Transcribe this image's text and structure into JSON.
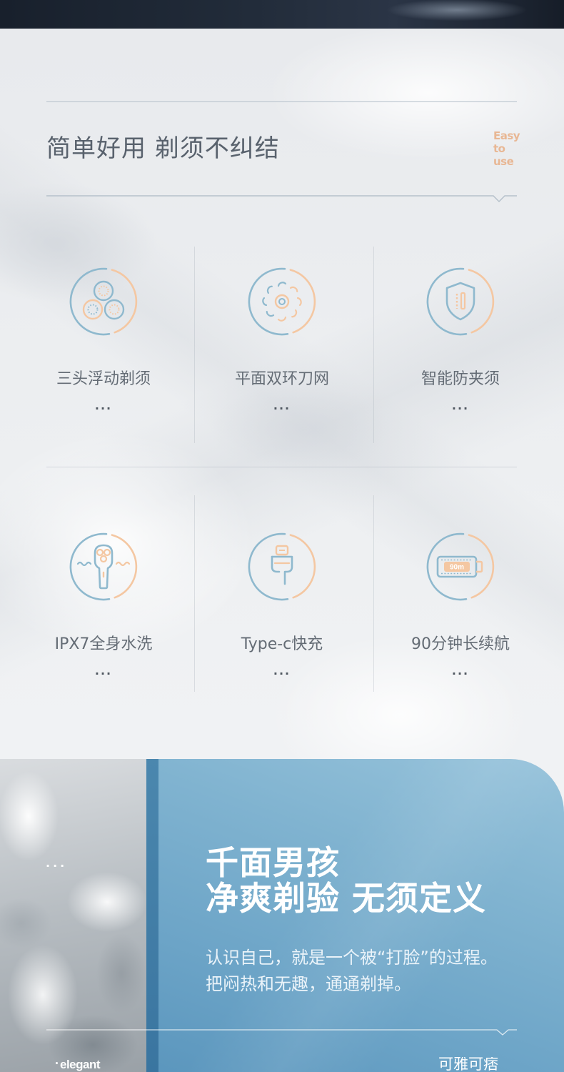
{
  "colors": {
    "accent_blue": "#8fb9ce",
    "accent_peach": "#f4c7a2",
    "title_gray": "#59626d",
    "panel_blue": "#6ca4c7"
  },
  "intro": {
    "title": "简单好用 剃须不纠结",
    "tag_lines": [
      "Easy",
      "to",
      "use"
    ]
  },
  "features": [
    {
      "icon": "three-heads-icon",
      "label": "三头浮动剃须",
      "more": "..."
    },
    {
      "icon": "dual-ring-blade-icon",
      "label": "平面双环刀网",
      "more": "..."
    },
    {
      "icon": "anti-pinch-shield-icon",
      "label": "智能防夹须",
      "more": "..."
    },
    {
      "icon": "waterproof-shaver-icon",
      "label": "IPX7全身水洗",
      "more": "..."
    },
    {
      "icon": "type-c-plug-icon",
      "label": "Type-c快充",
      "more": "..."
    },
    {
      "icon": "battery-icon",
      "label": "90分钟长续航",
      "more": "...",
      "badge": "90m"
    }
  ],
  "panel": {
    "side_dots": "...",
    "headline": [
      "千面男孩",
      "净爽剃验 无须定义"
    ],
    "body": [
      "认识自己，就是一个被“打脸”的过程。",
      "把闷热和无趣，通通剃掉。"
    ],
    "footer_left": "elegant",
    "footer_right": "可雅可痞"
  }
}
